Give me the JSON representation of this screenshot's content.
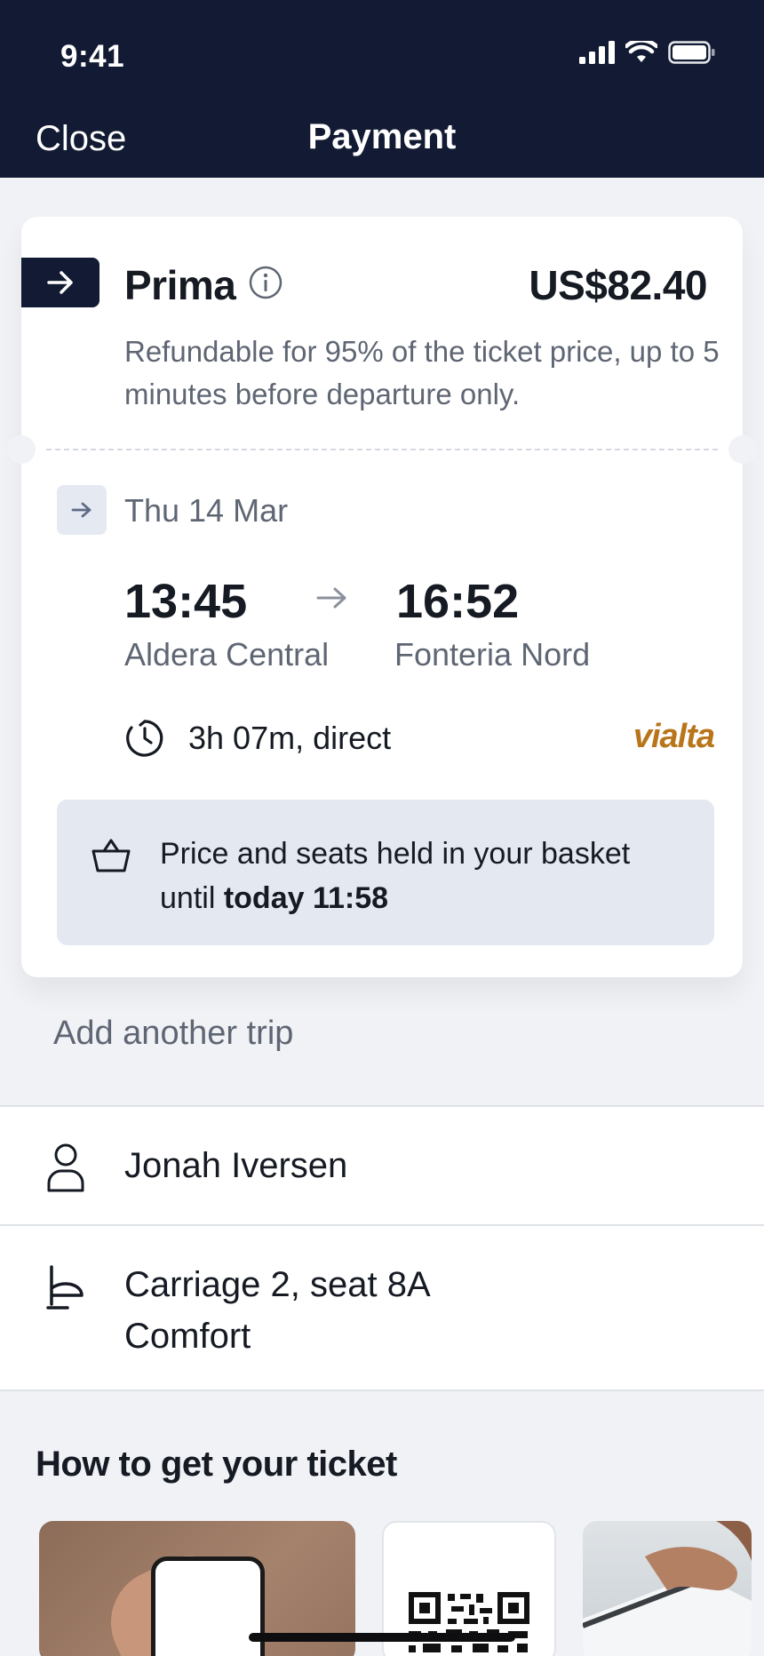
{
  "status_bar": {
    "time": "9:41"
  },
  "header": {
    "close_label": "Close",
    "title": "Payment"
  },
  "fare": {
    "name": "Prima",
    "price": "US$82.40",
    "description": "Refundable for 95% of the ticket price, up to 5 minutes before departure only."
  },
  "journey": {
    "date": "Thu 14 Mar",
    "departure_time": "13:45",
    "arrival_time": "16:52",
    "departure_station": "Aldera Central",
    "arrival_station": "Fonteria Nord",
    "duration": "3h 07m, direct",
    "operator": "vialta"
  },
  "hold_notice": {
    "text_prefix": "Price and seats held in your basket until ",
    "text_bold": "today 11:58"
  },
  "add_trip_label": "Add another trip",
  "passenger": {
    "name": "Jonah Iversen"
  },
  "seat": {
    "line1": "Carriage 2, seat 8A",
    "line2": "Comfort"
  },
  "ticket_section": {
    "title": "How to get your ticket"
  },
  "colors": {
    "header_bg": "#121b33",
    "operator_brand": "#b87519",
    "hold_bg": "#e3e8f1",
    "page_bg": "#f0f2f6"
  },
  "icons": [
    "signal-icon",
    "wifi-icon",
    "battery-icon",
    "arrow-right-icon",
    "info-icon",
    "clock-icon",
    "basket-icon",
    "person-icon",
    "seat-icon"
  ]
}
